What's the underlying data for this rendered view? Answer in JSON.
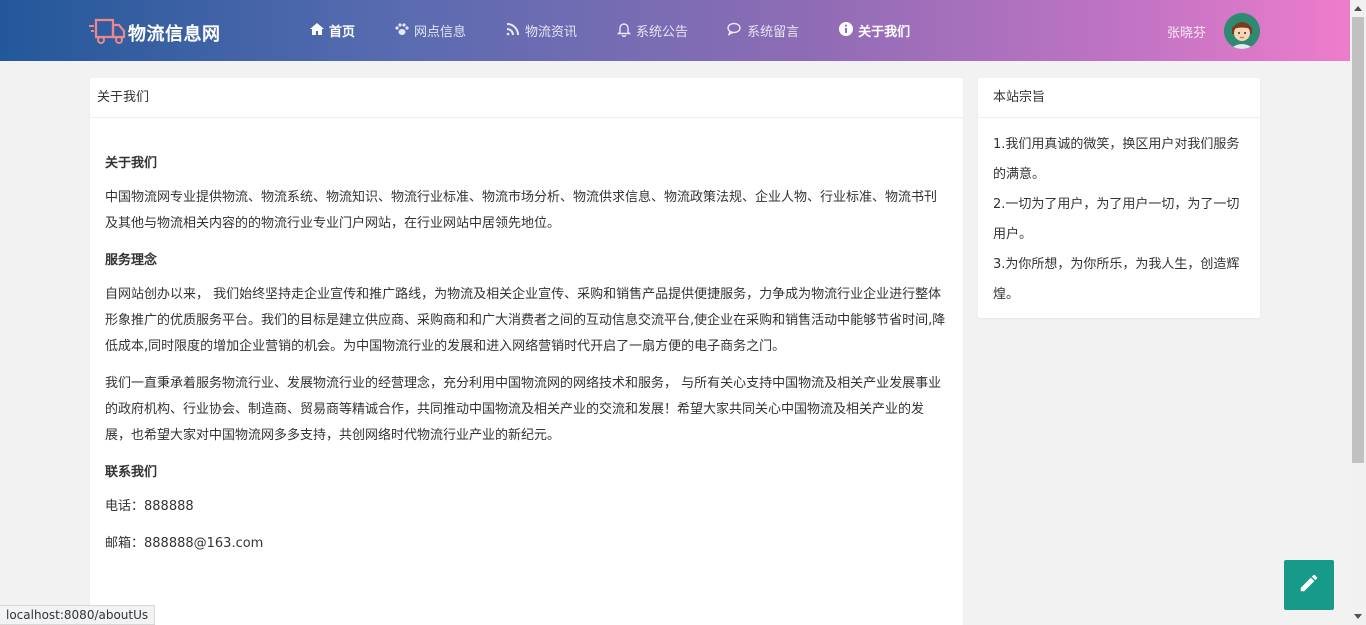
{
  "brand": {
    "name": "物流信息网",
    "logo_icon": "delivery-truck-icon"
  },
  "nav": [
    {
      "label": "首页",
      "icon": "home-icon"
    },
    {
      "label": "网点信息",
      "icon": "paw-icon"
    },
    {
      "label": "物流资讯",
      "icon": "rss-icon"
    },
    {
      "label": "系统公告",
      "icon": "bell-icon"
    },
    {
      "label": "系统留言",
      "icon": "chat-icon"
    },
    {
      "label": "关于我们",
      "icon": "info-icon"
    }
  ],
  "user": {
    "name": "张晓芬"
  },
  "main": {
    "header": "关于我们",
    "sections": {
      "about_title": "关于我们",
      "about_text": "中国物流网专业提供物流、物流系统、物流知识、物流行业标准、物流市场分析、物流供求信息、物流政策法规、企业人物、行业标准、物流书刊及其他与物流相关内容的的物流行业专业门户网站，在行业网站中居领先地位。",
      "service_title": "服务理念",
      "service_text_1": "自网站创办以来， 我们始终坚持走企业宣传和推广路线，为物流及相关企业宣传、采购和销售产品提供便捷服务，力争成为物流行业企业进行整体形象推广的优质服务平台。我们的目标是建立供应商、采购商和和广大消费者之间的互动信息交流平台,使企业在采购和销售活动中能够节省时间,降低成本,同时限度的增加企业营销的机会。为中国物流行业的发展和进入网络营销时代开启了一扇方便的电子商务之门。",
      "service_text_2": "我们一直秉承着服务物流行业、发展物流行业的经营理念，充分利用中国物流网的网络技术和服务， 与所有关心支持中国物流及相关产业发展事业的政府机构、行业协会、制造商、贸易商等精诚合作，共同推动中国物流及相关产业的交流和发展！希望大家共同关心中国物流及相关产业的发展，也希望大家对中国物流网多多支持，共创网络时代物流行业产业的新纪元。",
      "contact_title": "联系我们",
      "phone": "电话：888888",
      "email": "邮箱：888888@163.com"
    }
  },
  "side": {
    "header": "本站宗旨",
    "items": [
      "1.我们用真诚的微笑，换区用户对我们服务的满意。",
      "2.一切为了用户，为了用户一切，为了一切用户。",
      "3.为你所想，为你所乐，为我人生，创造辉煌。"
    ]
  },
  "fab": {
    "icon": "pencil-icon"
  },
  "status_bar": {
    "url": "localhost:8080/aboutUs"
  },
  "colors": {
    "header_gradient_start": "#22589a",
    "header_gradient_end": "#ee7ccb",
    "fab": "#179a8a"
  }
}
